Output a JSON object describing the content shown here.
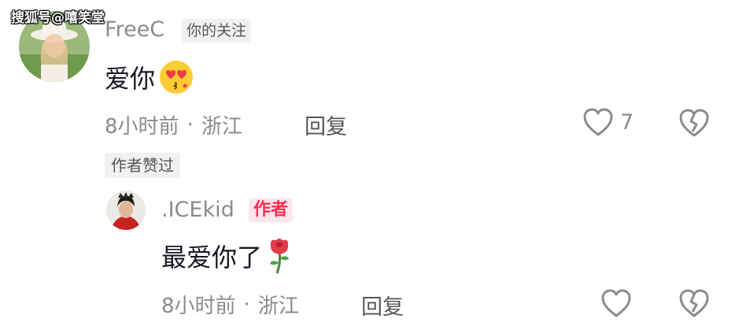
{
  "watermark": "搜狐号@嘻笑堂",
  "comment": {
    "username": "FreeC",
    "relation_tag": "你的关注",
    "text": "爱你",
    "emoji": "heart-eyes-kiss-emoji",
    "time": "8小时前",
    "separator": "·",
    "location": "浙江",
    "reply_label": "回复",
    "like_count": "7",
    "author_liked_tag": "作者赞过"
  },
  "reply": {
    "username": ".ICEkid",
    "author_tag": "作者",
    "text": "最爱你了",
    "emoji": "rose-emoji",
    "time": "8小时前",
    "separator": "·",
    "location": "浙江",
    "reply_label": "回复"
  },
  "colors": {
    "text_primary": "#161823",
    "text_secondary": "#8a8b91",
    "tag_bg": "#f1f1f2",
    "author_red": "#fe2c55"
  }
}
